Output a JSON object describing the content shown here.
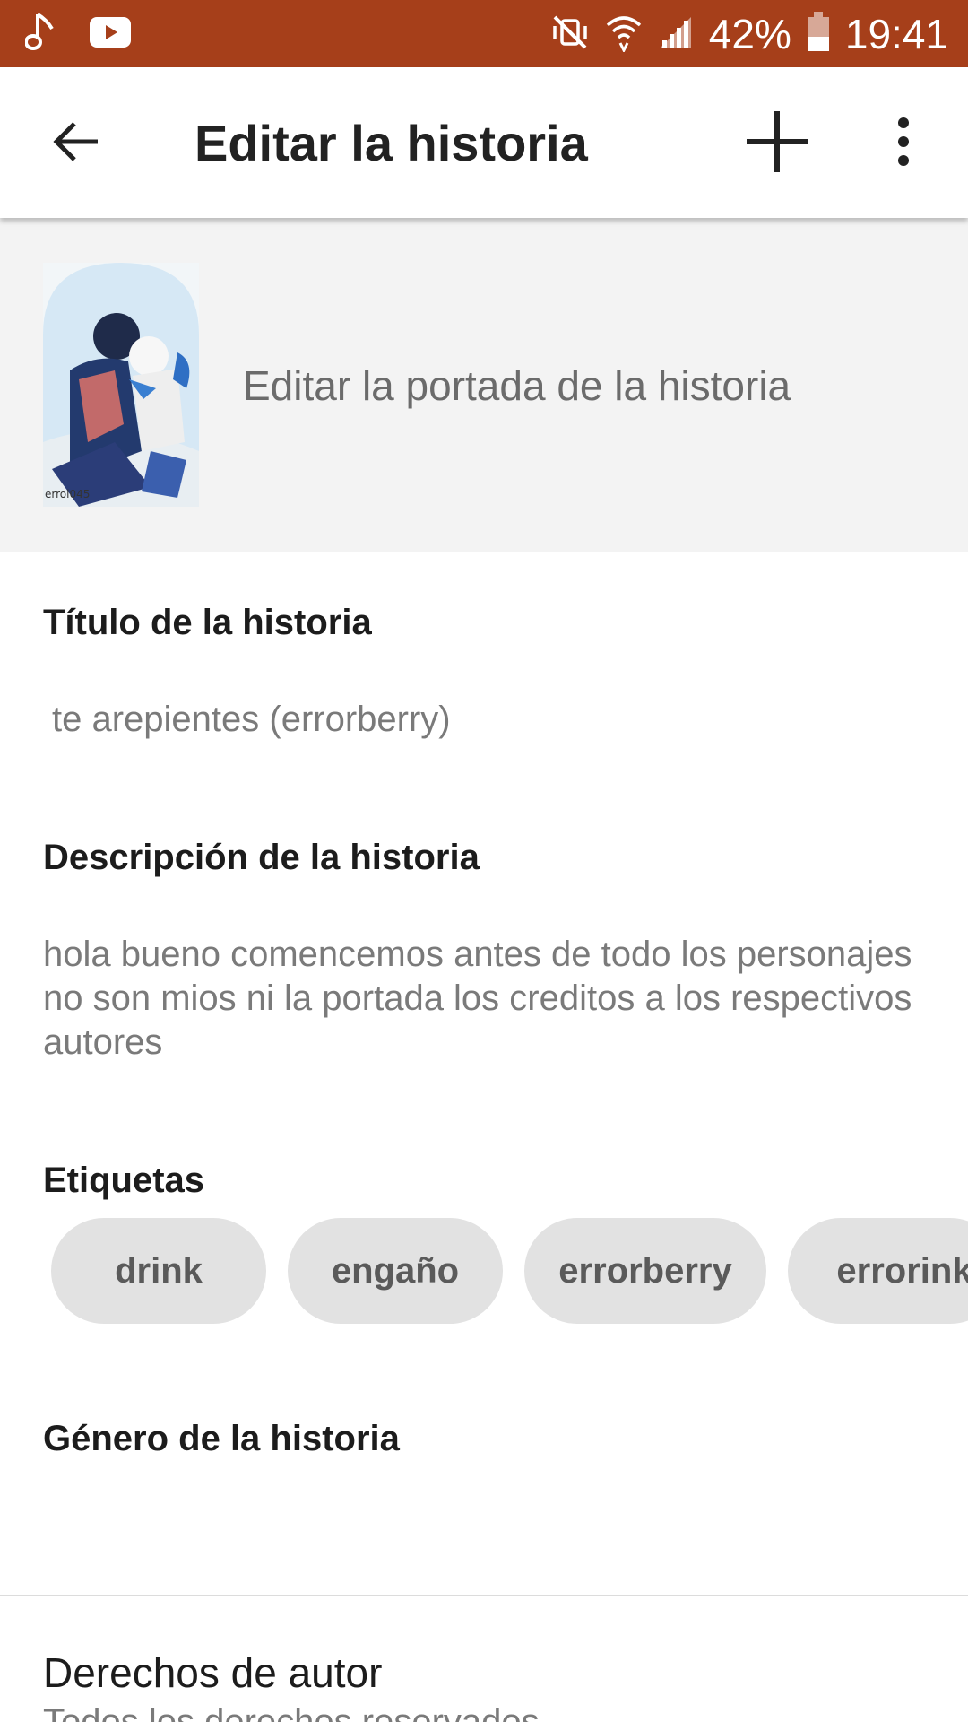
{
  "status_bar": {
    "battery": "42%",
    "time": "19:41",
    "icons": [
      "music-note-icon",
      "youtube-icon",
      "mute-vibrate-icon",
      "wifi-icon",
      "signal-icon",
      "battery-icon"
    ],
    "background_color": "#a63f1a"
  },
  "app_bar": {
    "title": "Editar la historia",
    "back_icon": "arrow-left-icon",
    "add_icon": "plus-icon",
    "more_icon": "more-vert-icon"
  },
  "cover": {
    "label": "Editar la portada de la historia",
    "thumb_caption": "errol045"
  },
  "story_title": {
    "label": "Título de la historia",
    "value": "te arepientes (errorberry)"
  },
  "description": {
    "label": "Descripción de la historia",
    "value": "hola bueno comencemos antes de todo los personajes no son mios ni la portada los creditos a los respectivos autores"
  },
  "tags": {
    "label": "Etiquetas",
    "items": [
      "drink",
      "engaño",
      "errorberry",
      "errorink"
    ]
  },
  "genre": {
    "label": "Género de la historia",
    "value": ""
  },
  "copyright": {
    "label": "Derechos de autor",
    "value": "Todos los derechos reservados"
  }
}
